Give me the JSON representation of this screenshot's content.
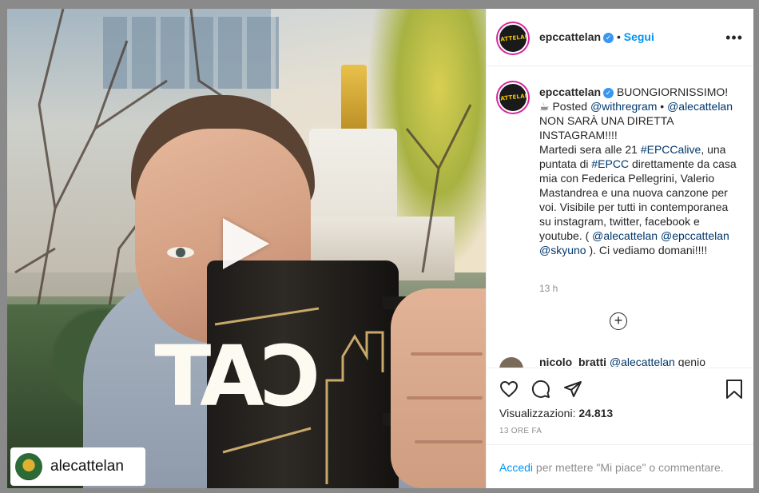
{
  "video": {
    "tag_username": "alecattelan",
    "mug_text": "CAT"
  },
  "post": {
    "author": "epccattelan",
    "follow_label": "Segui",
    "caption": {
      "author": "epccattelan",
      "line1": "BUONGIORNISSIMO!",
      "posted": "Posted",
      "mention1": "@withregram",
      "bullet": "•",
      "mention2": "@alecattelan",
      "text1": "NON SARÀ UNA DIRETTA INSTAGRAM!!!!",
      "text2": "Martedi sera alle 21",
      "hashtag1": "#EPCCalive",
      "text3": ", una puntata di",
      "hashtag2": "#EPCC",
      "text4": "direttamente da casa mia con Federica Pellegrini, Valerio Mastandrea e una nuova canzone per voi. Visibile per tutti in contemporanea su instagram, twitter, facebook e youtube. (",
      "mention3": "@alecattelan",
      "mention4": "@epccattelan",
      "mention5": "@skyuno",
      "text5": "). Ci vediamo domani!!!!"
    },
    "caption_time": "13 h",
    "comment_preview": {
      "user": "nicolo_bratti",
      "mention": "@alecattelan",
      "text": "genio"
    },
    "views_label": "Visualizzazioni:",
    "views_count": "24.813",
    "posted_ago": "13 ORE FA",
    "login_link": "Accedi",
    "login_text": "per mettere \"Mi piace\" o commentare."
  },
  "icons": {
    "heart": "heart-icon",
    "comment": "comment-icon",
    "share": "share-icon",
    "bookmark": "bookmark-icon",
    "more": "more-icon",
    "play": "play-icon",
    "add_comment": "plus-circle-icon"
  },
  "colors": {
    "link": "#00376b",
    "accent": "#0095f6",
    "verified": "#3897f0"
  }
}
